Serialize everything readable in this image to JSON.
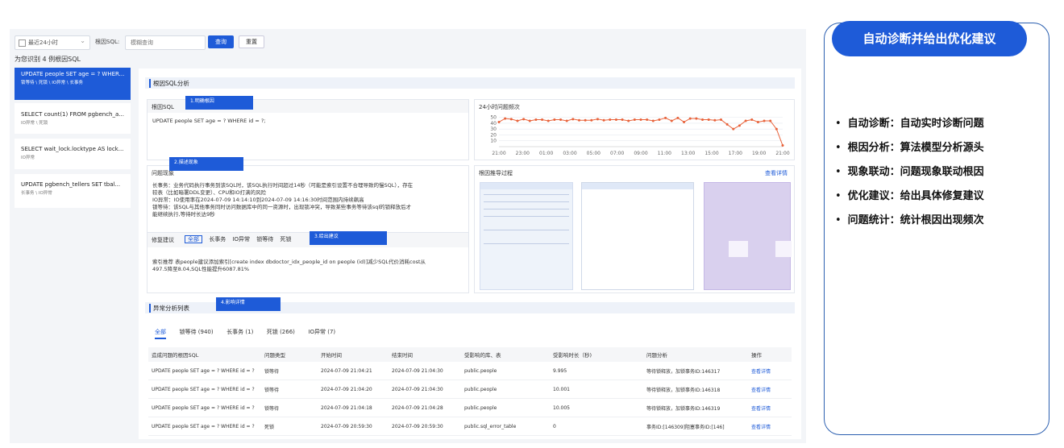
{
  "toolbar": {
    "time_select": "最近24小时",
    "root_sql_label": "根因SQL:",
    "root_sql_placeholder": "模糊查询",
    "query_button": "查询",
    "reset_button": "重置"
  },
  "found_text": "为您识别 4 例根因SQL",
  "sql_list": [
    {
      "title": "UPDATE people SET age = ? WHER...",
      "tags": "锁等待 \\ 死锁 \\ IO异常 \\ 长事务"
    },
    {
      "title": "SELECT count(1) FROM pgbench_a...",
      "tags": "IO异常 \\ 死锁"
    },
    {
      "title": "SELECT wait_lock.locktype AS lock...",
      "tags": "IO异常"
    },
    {
      "title": "UPDATE pgbench_tellers SET tbal...",
      "tags": "长事务 \\ IO异常"
    }
  ],
  "analysis": {
    "section_title": "根因SQL分析",
    "root_sql_box_title": "根因SQL",
    "tag1": "1.明确根因",
    "root_sql_text": "UPDATE people SET age = ? WHERE id = ?;",
    "trend_title": "24小时问题频次",
    "tag2": "2.描述现象",
    "phenomenon_title": "问题现象",
    "phenomenon_lines": [
      "长事务：业务代码执行事务到该SQL时，该SQL执行时间超过14秒（可能是索引设置不合理导致的慢SQL），存在",
      "较表（比如暗署DDL变更）、CPU和IO打满的风险",
      "IO异常：IO使用率在2024-07-09 14:14:10到2024-07-09 14:16:30时间范围内持续飙高",
      "锁等待：该SQL与其他事务同时访问数据库中的同一资源时，出现锁冲突，导致某些事务等待该sql的锁释放后才",
      "能继续执行,等待时长达9秒"
    ],
    "graph_title": "根因推导过程",
    "graph_link": "查看详情",
    "fix_title": "修复建议",
    "fix_tabs": [
      "全部",
      "长事务",
      "IO异常",
      "锁等待",
      "死锁"
    ],
    "tag3": "3.给出建议",
    "fix_lines": [
      "索引推荐 表people建议添加索引[create index dbdoctor_idx_people_id on people (id)]减少SQL代价消耗cost从",
      "497.5降至8.04,SQL性能提升6087.81%"
    ]
  },
  "chart_data": {
    "type": "line",
    "title": "24小时问题频次",
    "x_ticks": [
      "21:00",
      "23:00",
      "01:00",
      "03:00",
      "05:00",
      "07:00",
      "09:00",
      "11:00",
      "13:00",
      "15:00",
      "17:00",
      "19:00",
      "21:00"
    ],
    "y_ticks": [
      10,
      20,
      30,
      40,
      50
    ],
    "ylim": [
      0,
      55
    ],
    "values": [
      42,
      48,
      47,
      44,
      47,
      44,
      46,
      46,
      44,
      46,
      46,
      44,
      47,
      45,
      45,
      45,
      47,
      45,
      46,
      46,
      46,
      44,
      46,
      46,
      46,
      44,
      46,
      49,
      44,
      49,
      42,
      48,
      48,
      46,
      46,
      45,
      46,
      38,
      30,
      36,
      44,
      46,
      42,
      44,
      44,
      30,
      2
    ]
  },
  "anomaly": {
    "section_title": "异常分析列表",
    "tag4": "4.影响详情",
    "tabs": [
      "全部",
      "锁等待 (940)",
      "长事务 (1)",
      "死锁 (266)",
      "IO异常 (7)"
    ],
    "columns": [
      "造成问题的根因SQL",
      "问题类型",
      "开始时间",
      "结束时间",
      "受影响的库、表",
      "受影响时长（秒)",
      "问题分析",
      "操作"
    ],
    "rows": [
      [
        "UPDATE people SET age = ? WHERE id = ?",
        "锁等待",
        "2024-07-09 21:04:21",
        "2024-07-09 21:04:30",
        "public.people",
        "9.995",
        "等待锁释放，加锁事务ID:146317",
        "查看详情"
      ],
      [
        "UPDATE people SET age = ? WHERE id = ?",
        "锁等待",
        "2024-07-09 21:04:20",
        "2024-07-09 21:04:30",
        "public.people",
        "10.001",
        "等待锁释放，加锁事务ID:146318",
        "查看详情"
      ],
      [
        "UPDATE people SET age = ? WHERE id = ?",
        "锁等待",
        "2024-07-09 21:04:18",
        "2024-07-09 21:04:28",
        "public.people",
        "10.005",
        "等待锁释放，加锁事务ID:146319",
        "查看详情"
      ],
      [
        "UPDATE people SET age = ? WHERE id = ?",
        "死锁",
        "2024-07-09 20:59:30",
        "2024-07-09 20:59:30",
        "public.sql_error_table",
        "0",
        "事务ID:[146309]阻塞事务ID:[146]",
        "查看详情"
      ]
    ]
  },
  "right_panel": {
    "title": "自动诊断并给出优化建议",
    "features": [
      "自动诊断：自动实时诊断问题",
      "根因分析：算法模型分析源头",
      "现象联动：问题现象联动根因",
      "优化建议：给出具体修复建议",
      "问题统计：统计根因出现频次"
    ]
  },
  "colors": {
    "accent": "#1e5bd8",
    "line": "#e8623a",
    "panel_border": "#2b5fb0"
  }
}
